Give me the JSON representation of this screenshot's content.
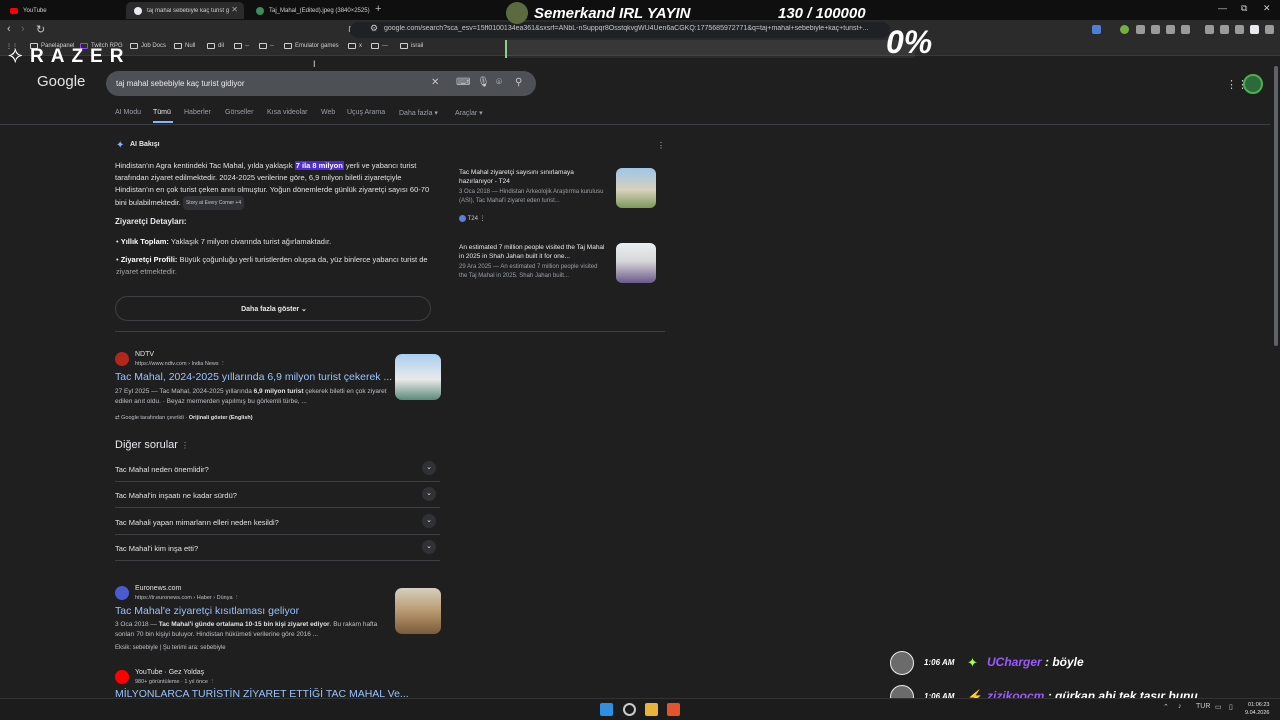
{
  "browser": {
    "tabs": [
      {
        "label": "YouTube",
        "color": "#ff0000"
      },
      {
        "label": "taj mahal sebebiyle kaç turist gi...",
        "color": "#e8eaed"
      },
      {
        "label": "Taj_Mahal_(Edited).jpeg (3840×2525)",
        "color": "#3b8e5a"
      }
    ],
    "url": "google.com/search?sca_esv=15ff0100134ea361&sxsrf=ANbL-nSuppqr8OsstqkvgWU4Uen6aCGKQ:1775685972771&q=taj+mahal+sebebiyle+kaç+turist+...",
    "bookmarks": [
      "Panelapanel",
      "Twitch RPG",
      "Job Docs",
      "Null",
      "dil",
      "--",
      "Emulator games",
      "x",
      "---",
      "israil"
    ]
  },
  "stream": {
    "title": "Semerkand IRL YAYIN",
    "count": "130 / 100000",
    "percent": "0%",
    "progress": 0.0013,
    "brand": "RAZER"
  },
  "google": {
    "logo": "Google",
    "query": "taj mahal sebebiyle kaç turist gidiyor",
    "tabs": [
      "AI Modu",
      "Tümü",
      "Haberler",
      "Görseller",
      "Kısa videolar",
      "Web",
      "Uçuş Arama",
      "Daha fazla",
      "Araçlar"
    ],
    "ai": {
      "header": "AI Bakışı",
      "p1_pre": "Hindistan'ın Agra kentindeki Tac Mahal, yılda yaklaşık ",
      "p1_hl": "7 ila 8 milyon",
      "p1_post": " yerli ve yabancı turist tarafından ziyaret edilmektedir. 2024-2025 verilerine göre, 6,9 milyon biletli ziyaretçiyle Hindistan'ın en çok turist çeken anıtı olmuştur. Yoğun dönemlerde günlük ziyaretçi sayısı 60-70 bini bulabilmektedir.",
      "chip": "Story at Every Corner +4",
      "details_heading": "Ziyaretçi Detayları:",
      "b1_label": "Yıllık Toplam:",
      "b1_text": " Yaklaşık 7 milyon civarında turist ağırlamaktadır.",
      "b2_label": "Ziyaretçi Profili:",
      "b2_text": " Büyük çoğunluğu yerli turistlerden oluşsa da, yüz binlerce yabancı turist de ziyaret etmektedir.",
      "show_more": "Daha fazla göster",
      "cards": [
        {
          "title": "Tac Mahal ziyaretçi sayısını sınırlamaya hazırlanıyor - T24",
          "snippet": "3 Oca 2018 — Hindistan Arkeolojik Araştırma kurulusu (ASI), Tac Mahal'i ziyaret eden turist...",
          "source": "T24"
        },
        {
          "title": "An estimated 7 million people visited the Taj Mahal in 2025 in Shah Jahan built it for one...",
          "snippet": "29 Ara 2025 — An estimated 7 million people visited the Taj Mahal in 2025. Shah Jahan built..."
        }
      ]
    },
    "results": [
      {
        "site": "NDTV",
        "url": "https://www.ndtv.com › India News",
        "title": "Tac Mahal, 2024-2025 yıllarında 6,9 milyon turist çekerek ...",
        "snippet_pre": "27 Eyl 2025 — Tac Mahal, 2024-2025 yıllarında ",
        "snippet_b": "6,9 milyon turist",
        "snippet_post": " çekerek biletli en çok ziyaret edilen anıt oldu. · Beyaz mermerden yapılmış bu görkemli türbe, ...",
        "translated": "Google tarafından çevrildi",
        "original": "Orijinali göster (English)"
      },
      {
        "site": "Euronews.com",
        "url": "https://tr.euronews.com › Haber › Dünya",
        "title": "Tac Mahal'e ziyaretçi kısıtlaması geliyor",
        "snippet_pre": "3 Oca 2018 — ",
        "snippet_b": "Tac Mahal'i günde ortalama 10-15 bin kişi ziyaret ediyor",
        "snippet_post": ". Bu rakam hafta sonları 70 bin kişiyi buluyor. Hindistan hükümeti verilerine göre 2016 ...",
        "missing": "Eksik: sebebiyle | Şu terimi ara: sebebiyle"
      },
      {
        "site": "YouTube · Gez Yoldaş",
        "url": "980+ görüntüleme · 1 yıl önce",
        "title": "MİLYONLARCA TURİSTİN ZİYARET ETTİĞİ TAC MAHAL Ve..."
      }
    ],
    "paa": {
      "heading": "Diğer sorular",
      "questions": [
        "Tac Mahal neden önemlidir?",
        "Tac Mahal'in inşaatı ne kadar sürdü?",
        "Tac Mahali yapan mimarların elleri neden kesildi?",
        "Tac Mahal'i kim inşa etti?"
      ]
    }
  },
  "chat": [
    {
      "time": "1:06 AM",
      "user": "UCharger",
      "message": " : böyle"
    },
    {
      "time": "1:06 AM",
      "user": "zizikoocm",
      "message": " : gürkan abi tek taşır bunu"
    }
  ],
  "taskbar": {
    "lang": "TUR",
    "time": "01:06:23",
    "date": "9.04.2026"
  }
}
